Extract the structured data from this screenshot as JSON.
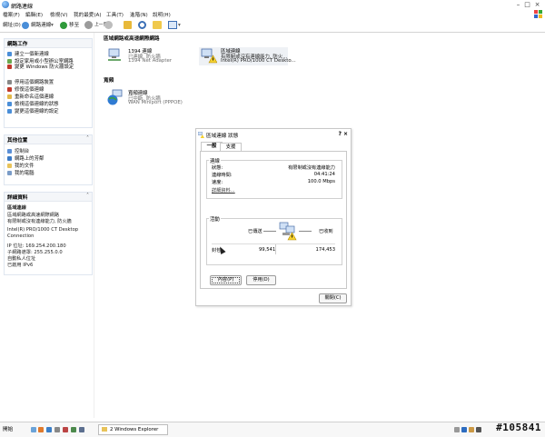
{
  "window": {
    "title": "網路連線"
  },
  "menu": [
    "檔案(F)",
    "編輯(E)",
    "檢視(V)",
    "我的最愛(A)",
    "工具(T)",
    "進階(N)",
    "說明(H)"
  ],
  "toolbar": {
    "back_label": "上一頁",
    "address_label": "網址(D)",
    "address_value": "網路連線",
    "go_label": "移至"
  },
  "left_panel": {
    "network_tasks": {
      "title": "網路工作",
      "items": [
        "建立一個新連線",
        "設定家用或小型辦公室網路",
        "變更 Windows 防火牆設定",
        "停用這個網路裝置",
        "修復這個連線",
        "重新命名這個連線",
        "檢視這個連線的狀態",
        "變更這個連線的設定"
      ]
    },
    "other_places": {
      "title": "其他位置",
      "items": [
        "控制台",
        "網路上的芳鄰",
        "我的文件",
        "我的電腦"
      ]
    },
    "details": {
      "title": "詳細資料",
      "name": "區域連線",
      "lines": [
        "區域網路或高速網際網路",
        "有限制或沒有連線能力, 防火牆",
        "Intel(R) PRO/1000 CT Desktop",
        "Connection",
        "IP 位址: 169.254.200.180",
        "子網路遮罩: 255.255.0.0",
        "自動私人位址",
        "已啟用 IPv6"
      ]
    }
  },
  "content": {
    "section_lan": "區域網路或高速網際網路",
    "section_broadband": "寬頻",
    "connections": [
      {
        "name": "1394 連線",
        "status": "已連線, 防火牆",
        "device": "1394 Net Adapter"
      },
      {
        "name": "區域連線",
        "status": "有限制或沒有連線能力, 防火...",
        "device": "Intel(R) PRO/1000 CT Deskto..."
      },
      {
        "name": "寬頻連線",
        "status": "已中斷, 防火牆",
        "device": "WAN Miniport (PPPOE)"
      }
    ]
  },
  "dialog": {
    "title": "區域連線 狀態",
    "tabs": [
      "一般",
      "支援"
    ],
    "connection_group": "連線",
    "status_label": "狀態:",
    "status_value": "有限制或沒有連線能力",
    "duration_label": "連線時間:",
    "duration_value": "04:41:24",
    "speed_label": "速度:",
    "speed_value": "100.0 Mbps",
    "detail_link": "詳細資料...",
    "activity_group": "活動",
    "sent_label": "已傳送",
    "received_label": "已收到",
    "packets_label": "封包:",
    "packets_sent": "99,541",
    "packets_received": "174,453",
    "properties_button": "內容(P)",
    "disable_button": "停用(D)",
    "close_button": "關閉(C)"
  },
  "taskbar": {
    "start_label": "開始",
    "task": "2 Windows Explorer"
  },
  "watermark": "#105841"
}
